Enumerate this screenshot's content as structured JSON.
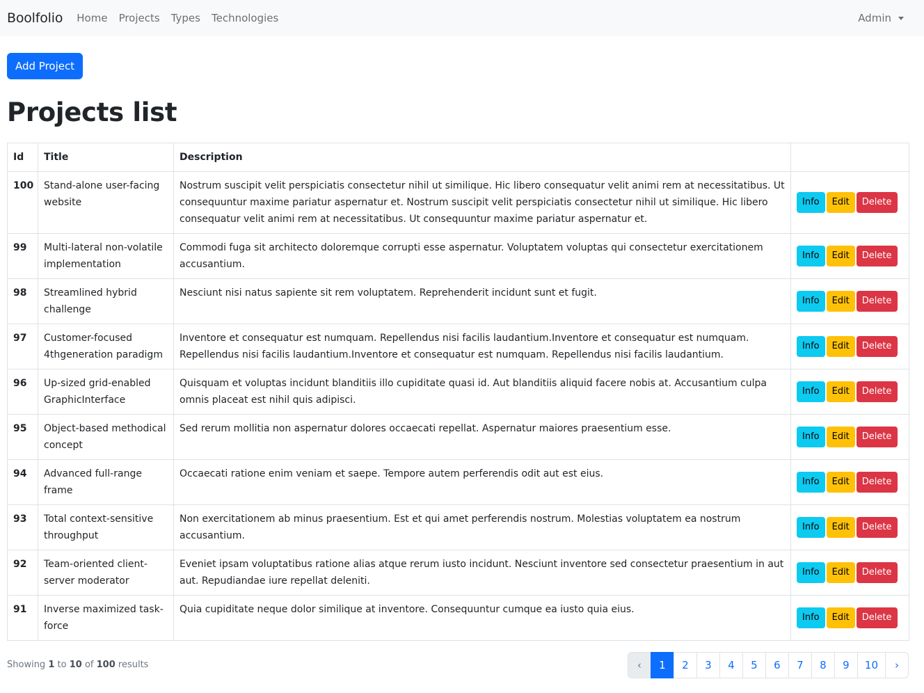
{
  "navbar": {
    "brand": "Boolfolio",
    "links": [
      "Home",
      "Projects",
      "Types",
      "Technologies"
    ],
    "user": "Admin"
  },
  "actions": {
    "add_label": "Add Project"
  },
  "page_title": "Projects list",
  "table": {
    "headers": [
      "Id",
      "Title",
      "Description",
      ""
    ],
    "button_labels": {
      "info": "Info",
      "edit": "Edit",
      "delete": "Delete"
    },
    "rows": [
      {
        "id": "100",
        "title": "Stand-alone user-facing website",
        "description": "Nostrum suscipit velit perspiciatis consectetur nihil ut similique. Hic libero consequatur velit animi rem at necessitatibus. Ut consequuntur maxime pariatur aspernatur et. Nostrum suscipit velit perspiciatis consectetur nihil ut similique. Hic libero consequatur velit animi rem at necessitatibus. Ut consequuntur maxime pariatur aspernatur et."
      },
      {
        "id": "99",
        "title": "Multi-lateral non-volatile implementation",
        "description": "Commodi fuga sit architecto doloremque corrupti esse aspernatur. Voluptatem voluptas qui consectetur exercitationem accusantium."
      },
      {
        "id": "98",
        "title": "Streamlined hybrid challenge",
        "description": "Nesciunt nisi natus sapiente sit rem voluptatem. Reprehenderit incidunt sunt et fugit."
      },
      {
        "id": "97",
        "title": "Customer-focused 4thgeneration paradigm",
        "description": "Inventore et consequatur est numquam. Repellendus nisi facilis laudantium.Inventore et consequatur est numquam. Repellendus nisi facilis laudantium.Inventore et consequatur est numquam. Repellendus nisi facilis laudantium."
      },
      {
        "id": "96",
        "title": "Up-sized grid-enabled GraphicInterface",
        "description": "Quisquam et voluptas incidunt blanditiis illo cupiditate quasi id. Aut blanditiis aliquid facere nobis at. Accusantium culpa omnis placeat est nihil quis adipisci."
      },
      {
        "id": "95",
        "title": "Object-based methodical concept",
        "description": "Sed rerum mollitia non aspernatur dolores occaecati repellat. Aspernatur maiores praesentium esse."
      },
      {
        "id": "94",
        "title": "Advanced full-range frame",
        "description": "Occaecati ratione enim veniam et saepe. Tempore autem perferendis odit aut est eius."
      },
      {
        "id": "93",
        "title": "Total context-sensitive throughput",
        "description": "Non exercitationem ab minus praesentium. Est et qui amet perferendis nostrum. Molestias voluptatem ea nostrum accusantium."
      },
      {
        "id": "92",
        "title": "Team-oriented client-server moderator",
        "description": "Eveniet ipsam voluptatibus ratione alias atque rerum iusto incidunt. Nesciunt inventore sed consectetur praesentium in aut aut. Repudiandae iure repellat deleniti."
      },
      {
        "id": "91",
        "title": "Inverse maximized task-force",
        "description": "Quia cupiditate neque dolor similique at inventore. Consequuntur cumque ea iusto quia eius."
      }
    ]
  },
  "footer": {
    "showing_prefix": "Showing",
    "from": "1",
    "to_word": "to",
    "to": "10",
    "of_word": "of",
    "total": "100",
    "results_word": "results"
  },
  "pagination": {
    "prev": "‹",
    "pages": [
      "1",
      "2",
      "3",
      "4",
      "5",
      "6",
      "7",
      "8",
      "9",
      "10"
    ],
    "active": "1",
    "next": "›"
  },
  "colors": {
    "primary": "#0d6efd",
    "info": "#0dcaf0",
    "warning": "#ffc107",
    "danger": "#dc3545"
  }
}
